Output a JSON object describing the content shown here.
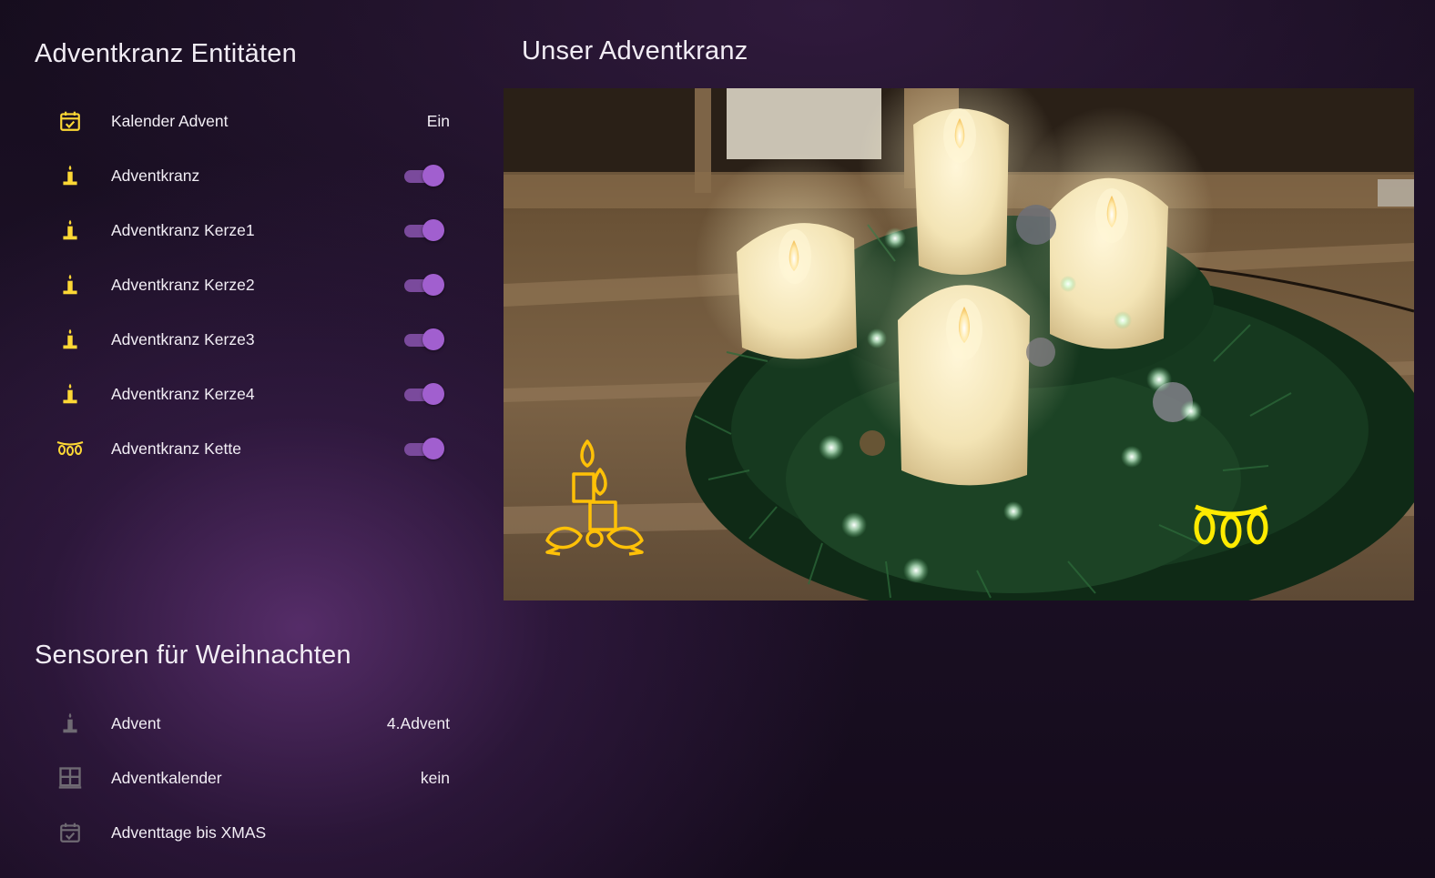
{
  "entities_card": {
    "title": "Adventkranz Entitäten",
    "rows": [
      {
        "icon": "calendar-check-icon",
        "name": "Kalender Advent",
        "state": "Ein"
      },
      {
        "icon": "candle-icon",
        "name": "Adventkranz",
        "toggle": true
      },
      {
        "icon": "candle-icon",
        "name": "Adventkranz Kerze1",
        "toggle": true
      },
      {
        "icon": "candle-icon",
        "name": "Adventkranz Kerze2",
        "toggle": true
      },
      {
        "icon": "candle-icon",
        "name": "Adventkranz Kerze3",
        "toggle": true
      },
      {
        "icon": "candle-icon",
        "name": "Adventkranz Kerze4",
        "toggle": true
      },
      {
        "icon": "string-lights-icon",
        "name": "Adventkranz Kette",
        "toggle": true
      }
    ]
  },
  "sensors_card": {
    "title": "Sensoren für Weihnachten",
    "rows": [
      {
        "icon": "candle-icon",
        "name": "Advent",
        "state": "4.Advent"
      },
      {
        "icon": "window-grid-icon",
        "name": "Adventkalender",
        "state": "kein"
      },
      {
        "icon": "calendar-check-icon",
        "name": "Adventtage bis XMAS",
        "state": ""
      }
    ]
  },
  "picture_card": {
    "title": "Unser Adventkranz",
    "overlay_icons": [
      "candles-icon",
      "string-lights-icon"
    ]
  },
  "colors": {
    "active_icon": "#fdd835",
    "inactive_icon": "#6f6a73",
    "toggle_on": "#a15fcf",
    "text": "#f2eef5"
  }
}
